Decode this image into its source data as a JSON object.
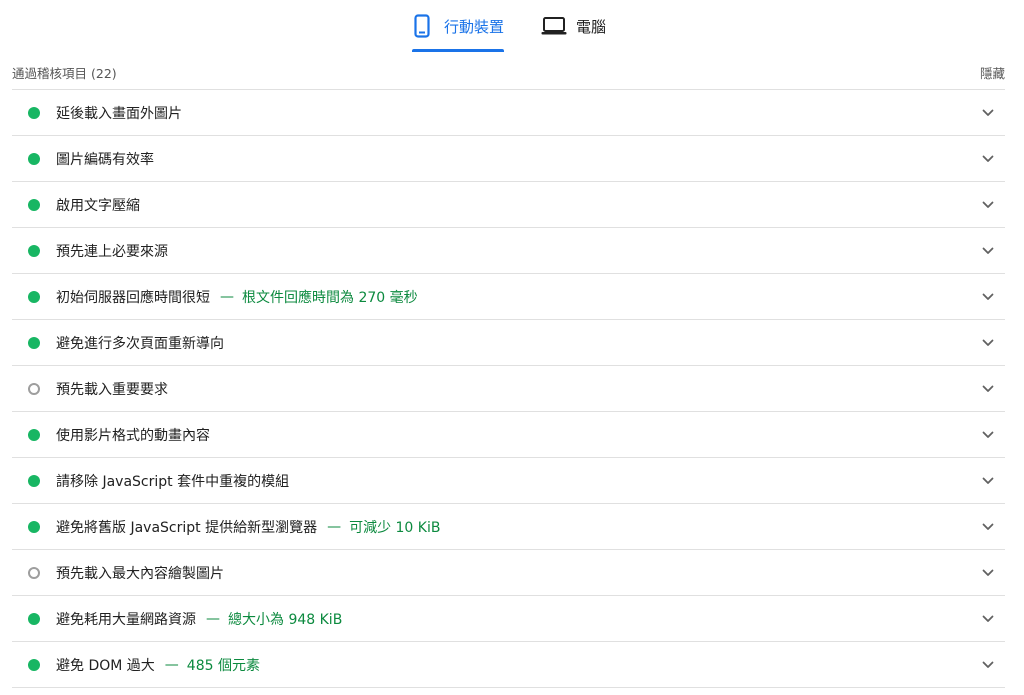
{
  "tabs": {
    "mobile_label": "行動裝置",
    "desktop_label": "電腦",
    "active": "mobile",
    "mobile_icon": "phone-icon",
    "desktop_icon": "laptop-icon"
  },
  "group": {
    "title": "通過稽核項目",
    "count": "(22)",
    "hide_label": "隱藏"
  },
  "colors": {
    "accent": "#1a73e8",
    "pass": "#18b663",
    "info_ring": "#9e9e9e",
    "display_value": "#0c8a3f"
  },
  "audits": [
    {
      "status": "pass",
      "title": "延後載入畫面外圖片",
      "display": ""
    },
    {
      "status": "pass",
      "title": "圖片編碼有效率",
      "display": ""
    },
    {
      "status": "pass",
      "title": "啟用文字壓縮",
      "display": ""
    },
    {
      "status": "pass",
      "title": "預先連上必要來源",
      "display": ""
    },
    {
      "status": "pass",
      "title": "初始伺服器回應時間很短",
      "display": "根文件回應時間為 270 毫秒"
    },
    {
      "status": "pass",
      "title": "避免進行多次頁面重新導向",
      "display": ""
    },
    {
      "status": "info",
      "title": "預先載入重要要求",
      "display": ""
    },
    {
      "status": "pass",
      "title": "使用影片格式的動畫內容",
      "display": ""
    },
    {
      "status": "pass",
      "title": "請移除 JavaScript 套件中重複的模組",
      "display": ""
    },
    {
      "status": "pass",
      "title": "避免將舊版 JavaScript 提供給新型瀏覽器",
      "display": "可減少 10 KiB"
    },
    {
      "status": "info",
      "title": "預先載入最大內容繪製圖片",
      "display": ""
    },
    {
      "status": "pass",
      "title": "避免耗用大量網路資源",
      "display": "總大小為 948 KiB"
    },
    {
      "status": "pass",
      "title": "避免 DOM 過大",
      "display": "485 個元素"
    }
  ],
  "separator": "—"
}
